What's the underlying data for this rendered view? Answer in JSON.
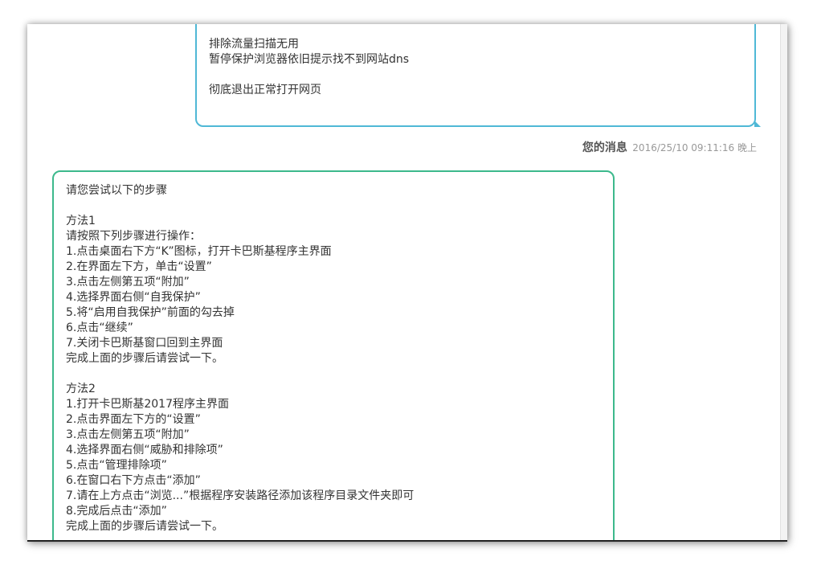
{
  "user_message": {
    "lines": [
      "排除流量扫描无用",
      "暂停保护浏览器依旧提示找不到网站dns",
      "",
      "彻底退出正常打开网页"
    ],
    "border_color": "#4fb8d6"
  },
  "message_meta": {
    "sender": "您的消息",
    "timestamp": "2016/25/10 09:11:16 晚上"
  },
  "agent_message": {
    "border_color": "#3cb98c",
    "lines": [
      "请您尝试以下的步骤",
      "",
      "方法1",
      "请按照下列步骤进行操作：",
      "1.点击桌面右下方“K”图标，打开卡巴斯基程序主界面",
      "2.在界面左下方，单击“设置”",
      "3.点击左侧第五项“附加”",
      "4.选择界面右侧“自我保护”",
      "5.将“启用自我保护”前面的勾去掉",
      "6.点击“继续”",
      "7.关闭卡巴斯基窗口回到主界面",
      "完成上面的步骤后请尝试一下。",
      "",
      "方法2",
      "1.打开卡巴斯基2017程序主界面",
      "2.点击界面左下方的“设置”",
      "3.点击左侧第五项“附加”",
      "4.选择界面右侧“威胁和排除项”",
      "5.点击“管理排除项”",
      "6.在窗口右下方点击“添加”",
      "7.请在上方点击“浏览...”根据程序安装路径添加该程序目录文件夹即可",
      "8.完成后点击“添加”",
      "完成上面的步骤后请尝试一下。"
    ]
  }
}
